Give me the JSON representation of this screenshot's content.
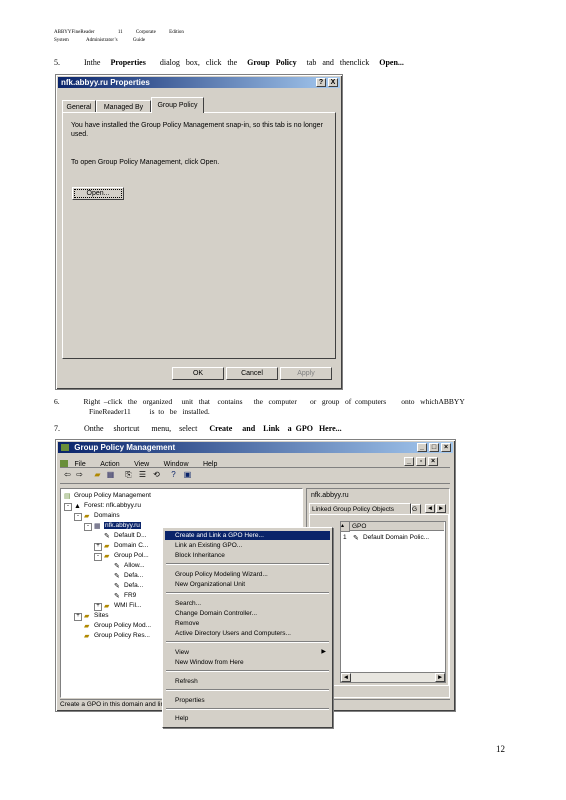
{
  "header": {
    "line1_a": "ABBYYFineReader",
    "line1_b": "11",
    "line1_c": "Corporate",
    "line1_d": "Edition",
    "line2_a": "System",
    "line2_b": "Administrator’s",
    "line2_c": "Guide"
  },
  "steps": {
    "s5_num": "5.",
    "s5_a": "Inthe",
    "s5_b": "Properties",
    "s5_c": "dialog   box,   click   the",
    "s5_d": "Group   Policy",
    "s5_e": "tab   and   thenclick",
    "s5_f": "Open...",
    "s6_num": "6.",
    "s6_line1": "Right  –click   the   organized     unit   that    contains      the   computer       or   group   of  computers        onto   whichABBYY",
    "s6_line2": "FineReader11          is  to   be   installed.",
    "s7_num": "7.",
    "s7_a": "Onthe     shortcut      menu,    select",
    "s7_b": "Create     and    Link    a  GPO   Here..."
  },
  "dialog": {
    "title": "nfk.abbyy.ru Properties",
    "help_btn": "?",
    "close_btn": "X",
    "tabs": [
      "General",
      "Managed By",
      "Group Policy"
    ],
    "message1": "You have installed the Group Policy Management snap-in, so this tab is no longer used.",
    "message2": "To open Group Policy Management, click Open.",
    "open_btn": "Open...",
    "ok_btn": "OK",
    "cancel_btn": "Cancel",
    "apply_btn": "Apply"
  },
  "gpm": {
    "title": "Group Policy Management",
    "menu": [
      "File",
      "Action",
      "View",
      "Window",
      "Help"
    ],
    "tree": [
      "Group Policy Management",
      "Forest: nfk.abbyy.ru",
      "Domains",
      "nfk.abbyy.ru",
      "Default D...",
      "Domain C...",
      "Group Pol...",
      "Allow...",
      "Defa...",
      "Defa...",
      "FR9",
      "WMI Fil...",
      "Sites",
      "Group Policy Mod...",
      "Group Policy Res..."
    ],
    "right_title": "nfk.abbyy.ru",
    "right_tab": "Linked Group Policy Objects",
    "right_tab2": "G",
    "col_order": "",
    "col_gpo": "GPO",
    "row_order": "1",
    "row_gpo": "Default Domain Polic...",
    "status": "Create a GPO in this domain and link it..."
  },
  "context_menu": {
    "items": [
      "Create and Link a GPO Here...",
      "Link an Existing GPO...",
      "Block Inheritance",
      "Group Policy Modeling Wizard...",
      "New Organizational Unit",
      "Search...",
      "Change Domain Controller...",
      "Remove",
      "Active Directory Users and Computers...",
      "View",
      "New Window from Here",
      "Refresh",
      "Properties",
      "Help"
    ]
  },
  "page_number": "12"
}
